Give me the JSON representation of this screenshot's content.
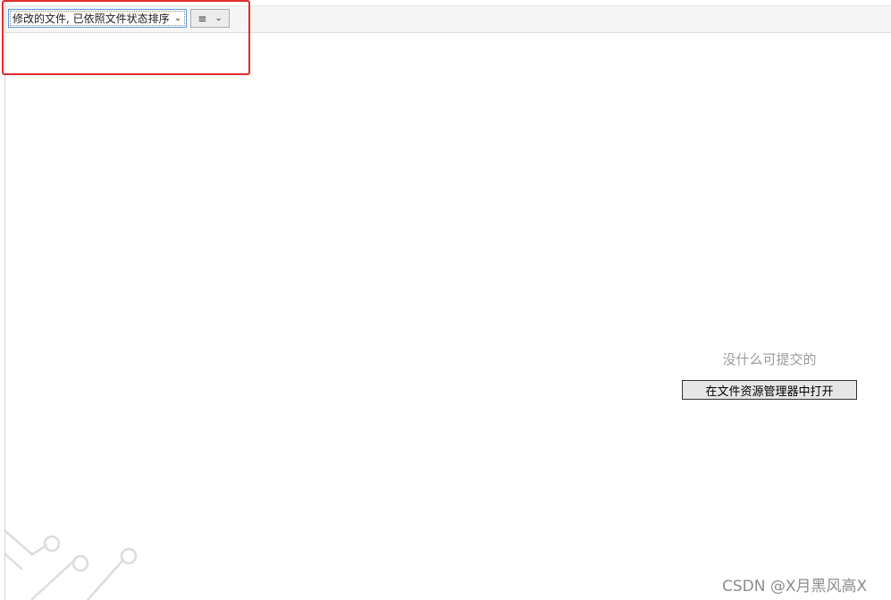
{
  "toolbar": {
    "view_select_value": "修改的文件, 已依照文件状态排序",
    "menu_icon": "hamburger-menu-icon",
    "chevron_icon": "chevron-down-icon"
  },
  "main": {
    "empty_message": "没什么可提交的",
    "open_explorer_label": "在文件资源管理器中打开"
  },
  "watermark": "CSDN @X月黑风高X",
  "colors": {
    "annotation_red": "#e02a2a",
    "focus_blue": "#5a9bd8"
  }
}
